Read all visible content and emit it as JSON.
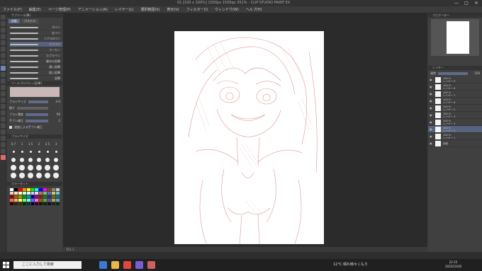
{
  "window": {
    "title": "01 [100 x 100%] 1500px 1500px 351% - CLIP STUDIO PAINT EX",
    "minimize": "—",
    "maximize": "□",
    "close": "✕"
  },
  "menu": [
    "ファイル(F)",
    "編集(E)",
    "ページ管理(P)",
    "アニメーション(A)",
    "レイヤー(L)",
    "選択範囲(S)",
    "表示(V)",
    "フィルター(I)",
    "ウィンドウ(W)",
    "ヘルプ(H)"
  ],
  "left_panel": {
    "subtool_header": "サブツール[筆]",
    "tabs": [
      "水彩",
      "パステル"
    ],
    "brushes": [
      "Gペン",
      "丸ペン",
      "リアルGペン",
      "ミリペン",
      "マーカー",
      "カブラペン",
      "硬めの鉛筆",
      "濃い鉛筆",
      "粗い鉛筆",
      "鉛筆"
    ],
    "prop_header": "ツールプロパティ[鉛筆]",
    "props": [
      {
        "label": "ブラシサイズ",
        "value": "4.0"
      },
      {
        "label": "硬さ",
        "value": ""
      },
      {
        "label": "ブラシ濃度",
        "value": "90"
      },
      {
        "label": "手ブレ補正",
        "value": "2"
      }
    ],
    "check_label": "速度による手ブレ補正",
    "tipsize_header": "ブラシサイズ",
    "tip_sizes": [
      "0.7",
      "1",
      "1.5",
      "2",
      "2.5",
      "3"
    ],
    "colorset_header": "カラーセット"
  },
  "canvas": {
    "status": "351.1"
  },
  "right_panel": {
    "navigator_header": "ナビゲーター",
    "layer_header": "レイヤー",
    "blend_mode": "通常",
    "opacity": "100",
    "layers": [
      {
        "opacity": "100 %",
        "mode": "通常",
        "name": "レイヤー 9"
      },
      {
        "opacity": "100 %",
        "mode": "通常",
        "name": "レイヤー 8"
      },
      {
        "opacity": "100 %",
        "mode": "通常",
        "name": "レイヤー 7"
      },
      {
        "opacity": "100 %",
        "mode": "通常",
        "name": "レイヤー 6"
      },
      {
        "opacity": "100 %",
        "mode": "通常",
        "name": "レイヤー 5"
      },
      {
        "opacity": "100 %",
        "mode": "通常",
        "name": "レイヤー 4"
      },
      {
        "opacity": "100 %",
        "mode": "通常",
        "name": "レイヤー 3"
      },
      {
        "opacity": "100 %",
        "mode": "通常",
        "name": "レイヤー 2"
      },
      {
        "opacity": "100 %",
        "mode": "通常",
        "name": "レイヤー 1"
      },
      {
        "opacity": "",
        "mode": "",
        "name": "用紙"
      }
    ]
  },
  "taskbar": {
    "search_placeholder": "ここに入力して検索",
    "weather": "12°C 晴れ時々くもり",
    "ime": "A",
    "time": "22:15",
    "date": "2022/10/30"
  }
}
